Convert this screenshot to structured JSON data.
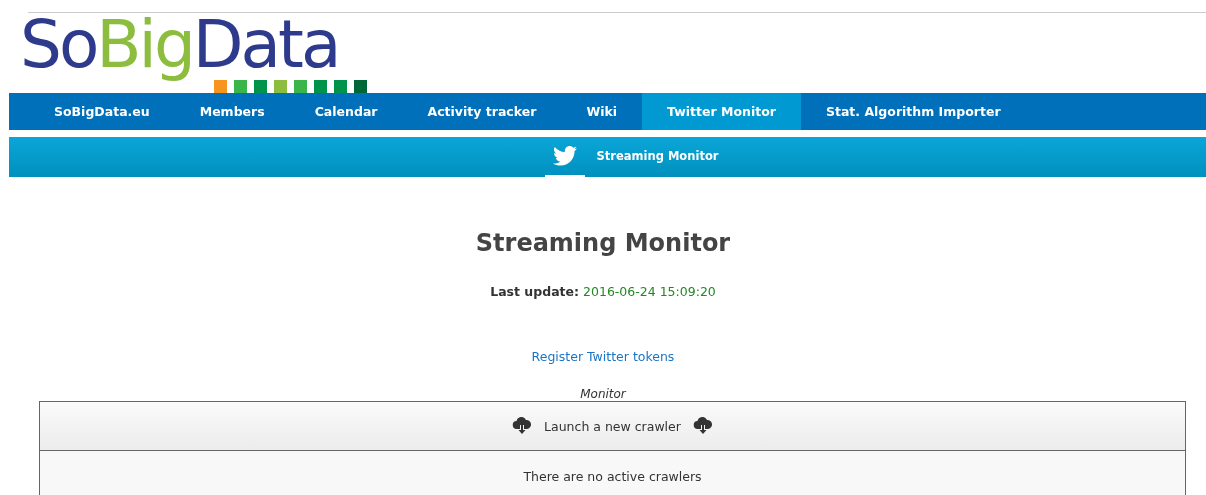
{
  "logo": {
    "parts": [
      {
        "text": "So",
        "color": "#2e3a8c"
      },
      {
        "text": "Big",
        "color": "#8cbd3f"
      },
      {
        "text": "Data",
        "color": "#2e3a8c"
      }
    ],
    "squares": [
      {
        "color": "#f7941d"
      },
      {
        "color": "#3ab54a"
      },
      {
        "color": "#00944a"
      },
      {
        "color": "#8cbd3f"
      },
      {
        "color": "#3ab54a"
      },
      {
        "color": "#00944a"
      },
      {
        "color": "#00944a"
      },
      {
        "color": "#006838"
      }
    ]
  },
  "nav": [
    {
      "label": "SoBigData.eu",
      "selected": false
    },
    {
      "label": "Members",
      "selected": false
    },
    {
      "label": "Calendar",
      "selected": false
    },
    {
      "label": "Activity tracker",
      "selected": false
    },
    {
      "label": "Wiki",
      "selected": false
    },
    {
      "label": "Twitter Monitor",
      "selected": true
    },
    {
      "label": "Stat. Algorithm Importer",
      "selected": false
    }
  ],
  "subnav": [
    {
      "kind": "icon",
      "selected": true
    },
    {
      "kind": "text",
      "label": "Streaming Monitor",
      "selected": false
    }
  ],
  "heading": "Streaming Monitor",
  "last_update": {
    "label": "Last update:",
    "value": "2016-06-24 15:09:20"
  },
  "link": "Register Twitter tokens",
  "table": {
    "caption": "Monitor",
    "launch": "Launch a new crawler",
    "empty": "There are no active crawlers"
  }
}
